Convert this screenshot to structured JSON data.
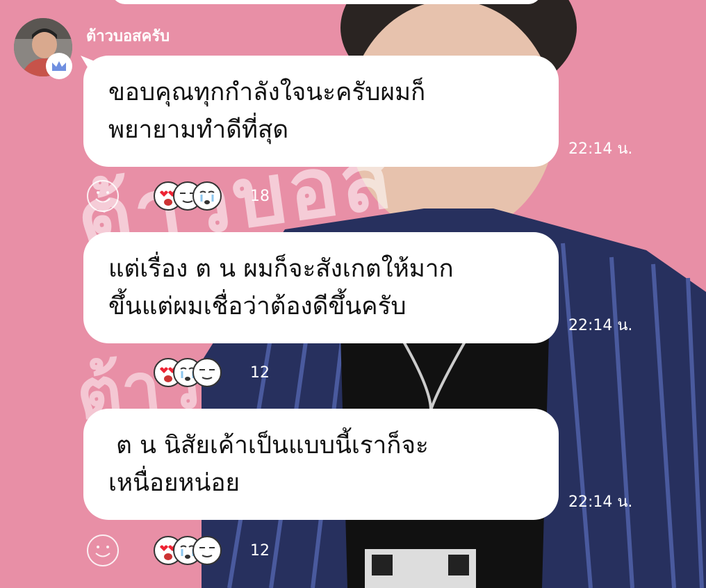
{
  "chat": {
    "sender_name": "ต้าวบอสครับ",
    "messages": [
      {
        "line1": "ขอบคุณทุกกำลังใจนะครับผมก็",
        "line2": "พยายามทำดีที่สุด",
        "time": "22:14 น.",
        "reaction_count": "18",
        "reactions": [
          "heart-eyes-face-icon",
          "smirk-face-icon",
          "crying-face-icon"
        ]
      },
      {
        "line1": "แต่เรื่อง ต น ผมก็จะสังเกตให้มาก",
        "line2": "ขึ้นแต่ผมเชื่อว่าต้องดีขึ้นครับ",
        "time": "22:14 น.",
        "reaction_count": "12",
        "reactions": [
          "heart-eyes-face-icon",
          "crying-face-icon",
          "smirk-face-icon"
        ]
      },
      {
        "line1": " ต น นิสัยเค้าเป็นแบบนี้เราก็จะ",
        "line2": "เหนื่อยหน่อย",
        "time": "22:14 น.",
        "reaction_count": "12",
        "reactions": [
          "heart-eyes-face-icon",
          "crying-face-icon",
          "smirk-face-icon"
        ]
      }
    ]
  },
  "colors": {
    "background": "#e88fa6",
    "bubble": "#ffffff",
    "text": "#111111",
    "badge_crown": "#6f8fe0"
  },
  "icons": {
    "add_reaction": "smiley-outline-icon",
    "avatar_badge": "crown-icon"
  }
}
